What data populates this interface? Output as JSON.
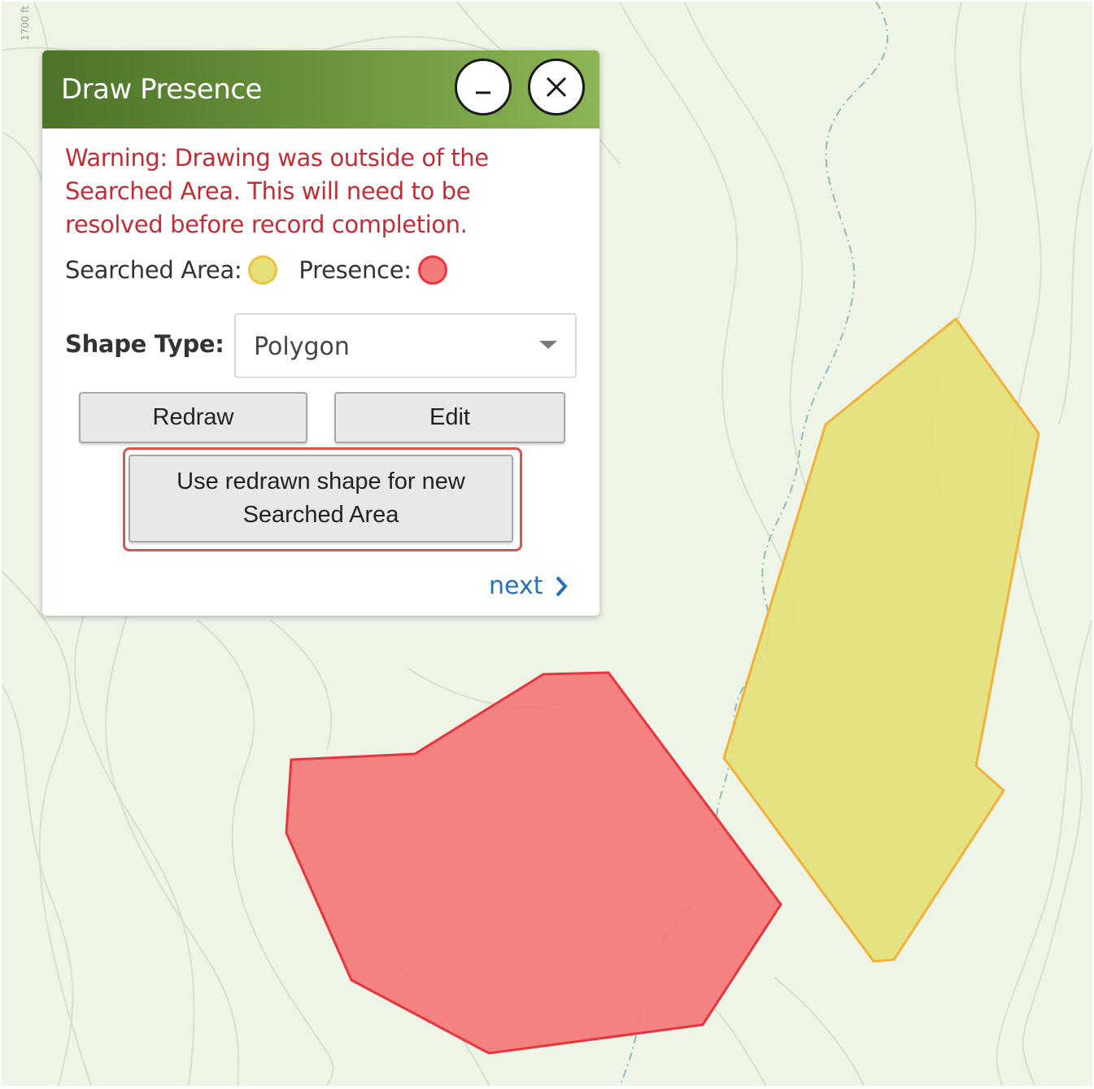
{
  "map": {
    "contour_label": "1700 ft",
    "searched_area_fill": "#e3e078",
    "searched_area_stroke": "#f0b23a",
    "presence_fill": "#f27b7a",
    "presence_stroke": "#e8353d"
  },
  "panel": {
    "title": "Draw Presence",
    "minimize_icon": "minimize-icon",
    "close_icon": "close-icon",
    "warning": "Warning: Drawing was outside of the Searched Area. This will need to be resolved before record completion.",
    "legend": {
      "searched_label": "Searched Area:",
      "presence_label": "Presence:"
    },
    "shape_type": {
      "label": "Shape Type:",
      "value": "Polygon"
    },
    "buttons": {
      "redraw": "Redraw",
      "edit": "Edit",
      "use_redrawn": "Use redrawn shape for new Searched Area"
    },
    "next_label": "next"
  }
}
